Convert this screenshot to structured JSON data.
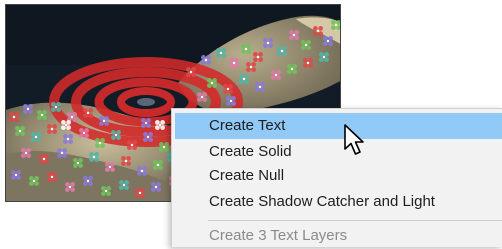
{
  "viewer": {
    "preview_image": "Composition preview: rocky terrain with red concentric target rings and colored tracking point markers",
    "colors": {
      "rings": "#d32a2a",
      "rock": "#9a9078",
      "background": "#121c26"
    }
  },
  "context_menu": {
    "items": [
      {
        "label": "Create Text",
        "highlighted": true,
        "enabled": true
      },
      {
        "label": "Create Solid",
        "enabled": true
      },
      {
        "label": "Create Null",
        "enabled": true
      },
      {
        "label": "Create Shadow Catcher and Light",
        "enabled": true
      },
      {
        "label": "Create 3 Text Layers",
        "enabled": false
      }
    ],
    "highlight_color": "#91c9f7"
  },
  "cursor": {
    "icon": "mouse-pointer-icon"
  }
}
